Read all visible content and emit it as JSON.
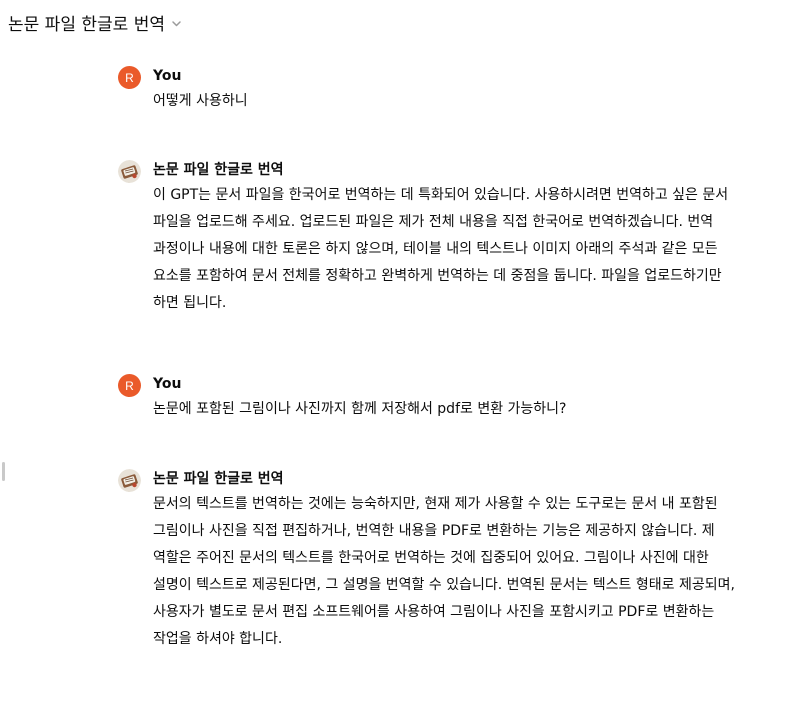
{
  "header": {
    "title": "논문 파일 한글로 번역",
    "chevron_icon": "chevron-down-icon"
  },
  "colors": {
    "user_avatar_bg": "#ea5a2a",
    "text": "#0d0d0d",
    "chevron": "#9b9b9b"
  },
  "messages": [
    {
      "role": "user",
      "avatar_initial": "R",
      "author": "You",
      "text": "어떻게 사용하니"
    },
    {
      "role": "assistant",
      "avatar_icon": "gpt-avatar-icon",
      "author": "논문 파일 한글로 번역",
      "text": "이 GPT는 문서 파일을 한국어로 번역하는 데 특화되어 있습니다. 사용하시려면 번역하고 싶은 문서 파일을 업로드해 주세요. 업로드된 파일은 제가 전체 내용을 직접 한국어로 번역하겠습니다. 번역 과정이나 내용에 대한 토론은 하지 않으며, 테이블 내의 텍스트나 이미지 아래의 주석과 같은 모든 요소를 포함하여 문서 전체를 정확하고 완벽하게 번역하는 데 중점을 둡니다. 파일을 업로드하기만 하면 됩니다."
    },
    {
      "role": "user",
      "avatar_initial": "R",
      "author": "You",
      "text": "논문에 포함된 그림이나 사진까지 함께 저장해서 pdf로 변환 가능하니?"
    },
    {
      "role": "assistant",
      "avatar_icon": "gpt-avatar-icon",
      "author": "논문 파일 한글로 번역",
      "text": "문서의 텍스트를 번역하는 것에는 능숙하지만, 현재 제가 사용할 수 있는 도구로는 문서 내 포함된 그림이나 사진을 직접 편집하거나, 번역한 내용을 PDF로 변환하는 기능은 제공하지 않습니다. 제 역할은 주어진 문서의 텍스트를 한국어로 번역하는 것에 집중되어 있어요. 그림이나 사진에 대한 설명이 텍스트로 제공된다면, 그 설명을 번역할 수 있습니다. 번역된 문서는 텍스트 형태로 제공되며, 사용자가 별도로 문서 편집 소프트웨어를 사용하여 그림이나 사진을 포함시키고 PDF로 변환하는 작업을 하셔야 합니다."
    }
  ]
}
